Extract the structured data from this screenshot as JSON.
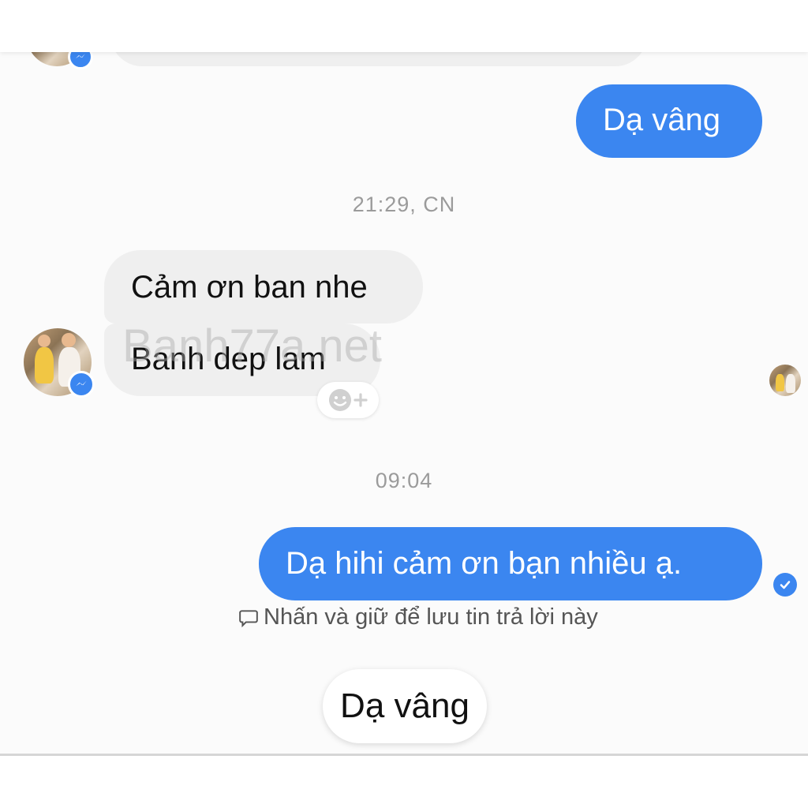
{
  "messages": [
    {
      "id": "m1",
      "direction": "out",
      "text": "Dạ vâng"
    },
    {
      "id": "m2",
      "direction": "in",
      "text": "Cảm ơn ban nhe"
    },
    {
      "id": "m3",
      "direction": "in",
      "text": "Banh dep lam"
    },
    {
      "id": "m4",
      "direction": "out",
      "text": "Dạ hihi cảm ơn bạn nhiều ạ."
    }
  ],
  "timestamps": {
    "first": "21:29, CN",
    "second": "09:04"
  },
  "watermark": "Banh77a.net",
  "hint": {
    "text": "Nhấn và giữ để lưu tin trả lời này",
    "icon": "speech-bubble-icon"
  },
  "quick_reply": {
    "label": "Dạ vâng"
  },
  "reaction_button": {
    "icon": "add-reaction-icon"
  },
  "colors": {
    "outgoing_bubble": "#3b86f0",
    "incoming_bubble": "#efefef",
    "messenger_badge": "#3b86f0"
  }
}
